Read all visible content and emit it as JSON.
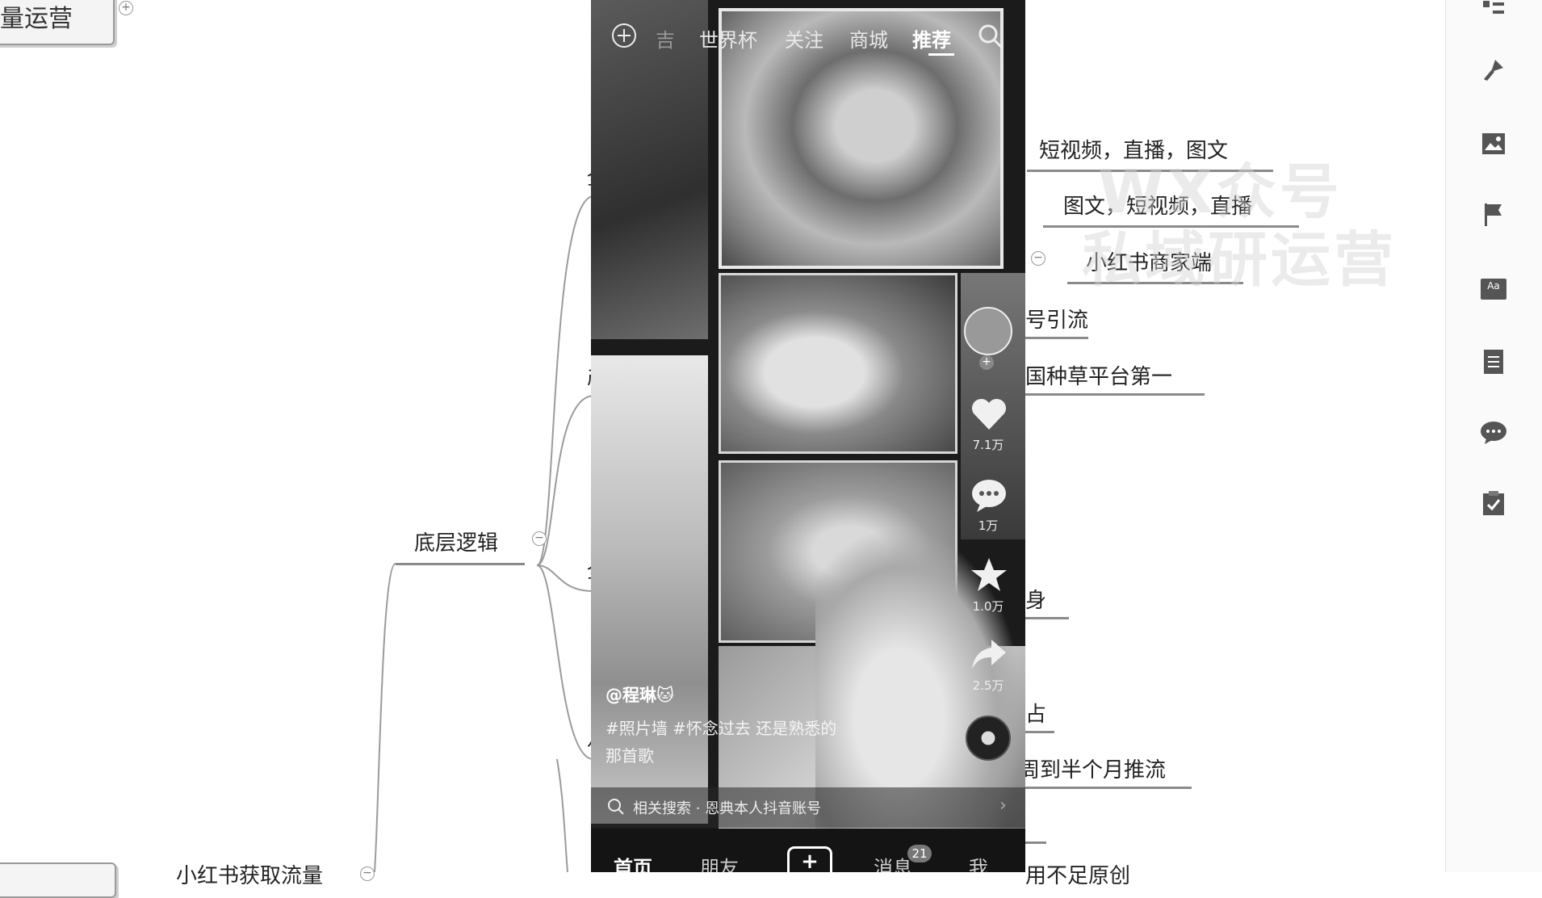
{
  "mindmap": {
    "top_left_node": "量运营",
    "central_node": "底层逻辑",
    "bottom_node": "小红书获取流量",
    "right_nodes": [
      "短视频，直播，图文",
      "图文，短视频，直播",
      "小红书商家端",
      "号引流",
      "国种草平台第一",
      "身",
      "占",
      "周到半个月推流",
      "用不足原创"
    ],
    "left_branch_fragments": [
      "全",
      "产",
      "全",
      "八"
    ],
    "watermark_line1": "WX众号",
    "watermark_line2": "私域研运营"
  },
  "phone": {
    "top_tabs": [
      "世界杯",
      "关注",
      "商城",
      "推荐"
    ],
    "active_tab": "推荐",
    "top_tab_partial": "吉",
    "counts": {
      "likes": "7.1万",
      "comments": "1万",
      "favorites": "1.0万",
      "shares": "2.5万"
    },
    "author": "@程琳🐱",
    "caption": "#照片墙 #怀念过去 还是熟悉的那首歌",
    "related_search": "相关搜索 · 恩典本人抖音账号",
    "bottom_tabs": [
      "首页",
      "朋友",
      "消息",
      "我"
    ],
    "message_badge": "21",
    "plus_label": "+"
  },
  "toolbar": {
    "icons": [
      "outline-icon",
      "format-painter-icon",
      "image-icon",
      "flag-icon",
      "style-icon",
      "note-icon",
      "comment-icon",
      "task-icon"
    ],
    "style_icon_text": "Aa"
  },
  "colors": {
    "node_line": "#8a8a8a",
    "phone_bg": "#1b1b1b",
    "toolbar_bg": "#fafafa"
  }
}
